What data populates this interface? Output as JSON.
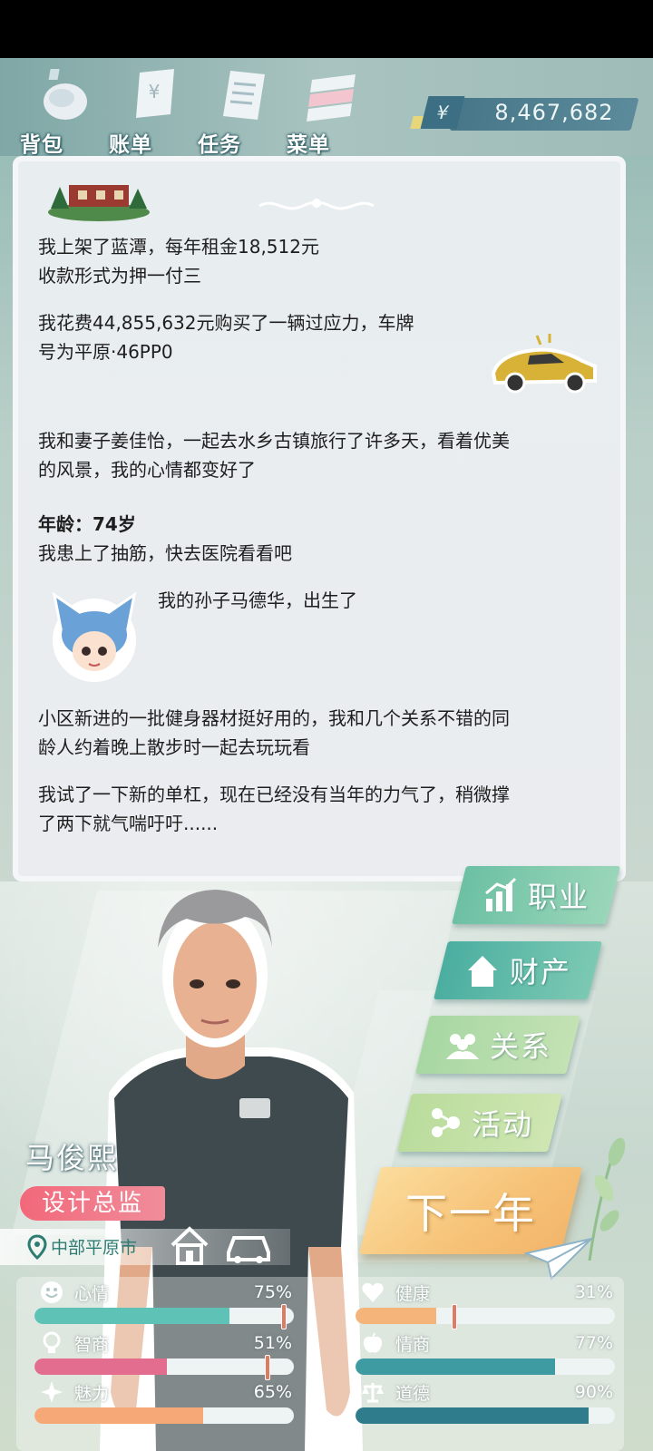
{
  "toolbar": {
    "items": [
      {
        "label": "背包",
        "icon": "backpack-icon"
      },
      {
        "label": "账单",
        "icon": "bill-icon"
      },
      {
        "label": "任务",
        "icon": "task-icon"
      },
      {
        "label": "菜单",
        "icon": "menu-icon"
      }
    ],
    "money_symbol": "¥",
    "money": "8,467,682"
  },
  "log": {
    "entries": [
      "我上架了蓝潭，每年租金18,512元",
      "收款形式为押一付三",
      "我花费44,855,632元购买了一辆过应力，车牌",
      "号为平原·46PP0",
      "我和妻子姜佳怡，一起去水乡古镇旅行了许多天，看着优美",
      "的风景，我的心情都变好了",
      "年龄：74岁",
      "我患上了抽筋，快去医院看看吧",
      "我的孙子马德华，出生了",
      "小区新进的一批健身器材挺好用的，我和几个关系不错的同",
      "龄人约着晚上散步时一起去玩玩看",
      "我试了一下新的单杠，现在已经没有当年的力气了，稍微撑",
      "了两下就气喘吁吁......"
    ]
  },
  "menu": {
    "career": "职业",
    "property": "财产",
    "relations": "关系",
    "activities": "活动",
    "next_year": "下一年"
  },
  "character": {
    "name": "马俊熙",
    "job": "设计总监",
    "location": "中部平原市"
  },
  "stats": {
    "mood": {
      "label": "心情",
      "value": "75%",
      "fraction": 0.75,
      "color": "#5fc2b7"
    },
    "health": {
      "label": "健康",
      "value": "31%",
      "fraction": 0.31,
      "color": "#f5b57a"
    },
    "iq": {
      "label": "智商",
      "value": "51%",
      "fraction": 0.51,
      "color": "#e26d8e"
    },
    "eq": {
      "label": "情商",
      "value": "77%",
      "fraction": 0.77,
      "color": "#3e9ba1"
    },
    "charm": {
      "label": "魅力",
      "value": "65%",
      "fraction": 0.65,
      "color": "#f7a877"
    },
    "morality": {
      "label": "道德",
      "value": "90%",
      "fraction": 0.9,
      "color": "#2f7d8c"
    }
  }
}
